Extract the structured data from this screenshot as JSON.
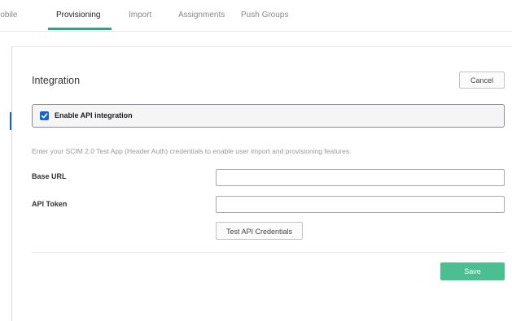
{
  "tabs": [
    {
      "label": "Mobile"
    },
    {
      "label": "Provisioning"
    },
    {
      "label": "Import"
    },
    {
      "label": "Assignments"
    },
    {
      "label": "Push Groups"
    }
  ],
  "colors": {
    "accent": "#2ba682",
    "save_button": "#4cbf92",
    "checkbox": "#1662dd"
  },
  "integration": {
    "title": "Integration",
    "cancel_label": "Cancel",
    "enable_api_label": "Enable API integration",
    "enable_api_checked": true,
    "info_text": "Enter your SCIM 2.0 Test App (Header Auth) credentials to enable user import and provisioning features.",
    "base_url": {
      "label": "Base URL",
      "value": ""
    },
    "api_token": {
      "label": "API Token",
      "value": ""
    },
    "test_button_label": "Test API Credentials",
    "save_label": "Save"
  }
}
